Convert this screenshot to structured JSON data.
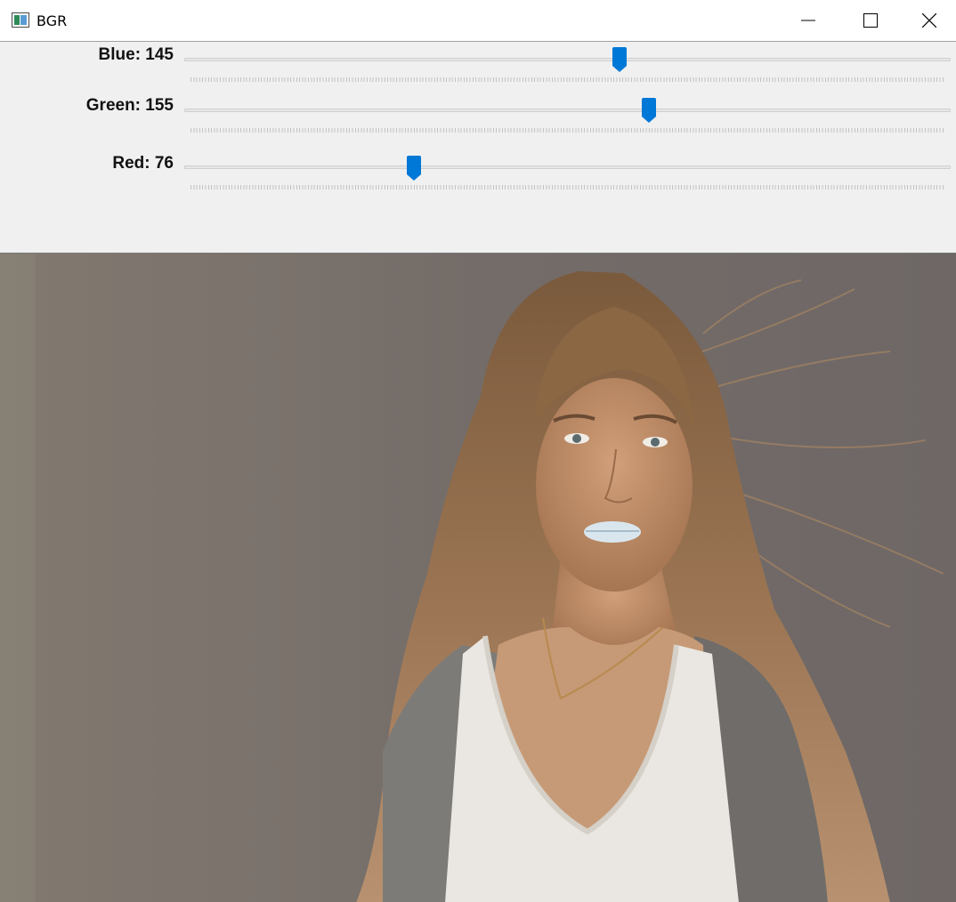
{
  "window": {
    "title": "BGR"
  },
  "titlebar_buttons": [
    "minimize-icon",
    "maximize-icon",
    "close-icon"
  ],
  "trackbars": [
    {
      "label": "Blue: 145",
      "value": 145,
      "max": 255
    },
    {
      "label": "Green: 155",
      "value": 155,
      "max": 255
    },
    {
      "label": "Red: 76",
      "value": 76,
      "max": 255
    }
  ],
  "colors": {
    "thumb": "#0078d7",
    "track": "#e6e6e6",
    "panel": "#f0f0f0",
    "background": "#736b67"
  },
  "image": {
    "description_icon": "portrait-photo"
  }
}
